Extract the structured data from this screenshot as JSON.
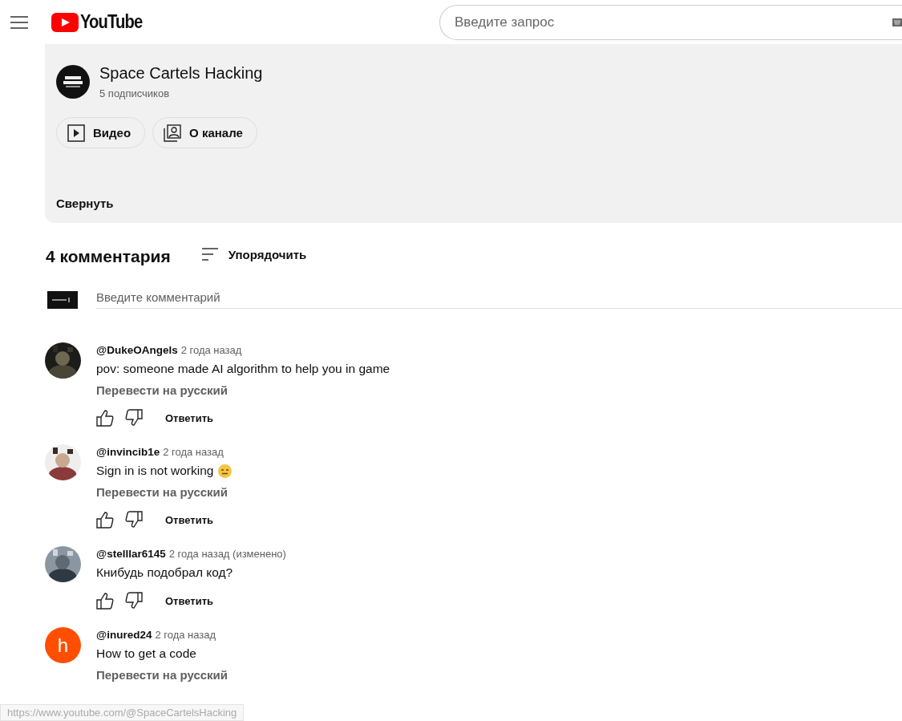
{
  "header": {
    "logo": "YouTube",
    "search": {
      "placeholder": "Введите запрос"
    }
  },
  "channel": {
    "name": "Space Cartels Hacking",
    "subscribers": "5 подписчиков",
    "tabs": [
      {
        "label": "Видео",
        "kind": "video"
      },
      {
        "label": "О канале",
        "kind": "about"
      }
    ],
    "collapse": "Свернуть"
  },
  "comments_header": {
    "count": "4 комментария",
    "sort": "Упорядочить"
  },
  "comment_input": {
    "placeholder": "Введите комментарий"
  },
  "comments": [
    {
      "author": "@DukeOAngels",
      "time": "2 года назад",
      "text": "pov: someone made AI algorithm to help you in game",
      "emoji": false,
      "translate": "Перевести на русский",
      "reply": "Ответить"
    },
    {
      "author": "@invincib1e",
      "time": "2 года назад",
      "text": "Sign in is not working",
      "emoji": true,
      "translate": "Перевести на русский",
      "reply": "Ответить"
    },
    {
      "author": "@stelllar6145",
      "time": "2 года назад (изменено)",
      "text": "Книбудь подобрал код?",
      "emoji": false,
      "reply": "Ответить"
    },
    {
      "author": "@inured24",
      "time": "2 года назад",
      "text": "How to get a code",
      "emoji": false,
      "translate": "Перевести на русский",
      "avatar": {
        "kind": "letter",
        "letter": "h",
        "color": "#ff4e00"
      }
    }
  ],
  "status_url": "https://www.youtube.com/@SpaceCartelsHacking"
}
